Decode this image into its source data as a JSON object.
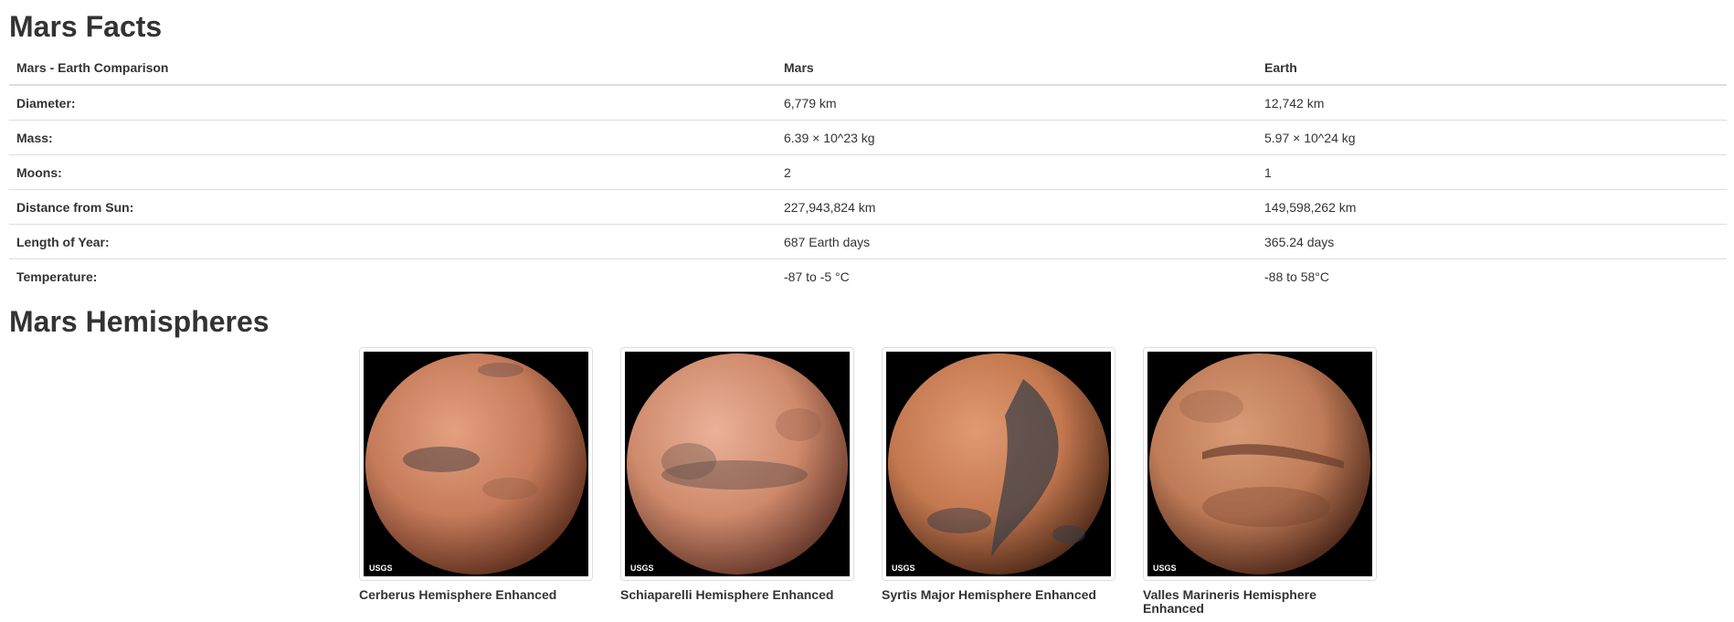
{
  "facts": {
    "title": "Mars Facts",
    "headers": [
      "Mars - Earth Comparison",
      "Mars",
      "Earth"
    ],
    "rows": [
      [
        "Diameter:",
        "6,779 km",
        "12,742 km"
      ],
      [
        "Mass:",
        "6.39 × 10^23 kg",
        "5.97 × 10^24 kg"
      ],
      [
        "Moons:",
        "2",
        "1"
      ],
      [
        "Distance from Sun:",
        "227,943,824 km",
        "149,598,262 km"
      ],
      [
        "Length of Year:",
        "687 Earth days",
        "365.24 days"
      ],
      [
        "Temperature:",
        "-87 to -5 °C",
        "-88 to 58°C"
      ]
    ]
  },
  "hemispheres": {
    "title": "Mars Hemispheres",
    "items": [
      {
        "title": "Cerberus Hemisphere Enhanced",
        "watermark": "USGS",
        "base": "#c67b5a",
        "dark": "#4e4444"
      },
      {
        "title": "Schiaparelli Hemisphere Enhanced",
        "watermark": "USGS",
        "base": "#cf8a6c",
        "dark": "#5c4a44"
      },
      {
        "title": "Syrtis Major Hemisphere Enhanced",
        "watermark": "USGS",
        "base": "#c4784f",
        "dark": "#353c46"
      },
      {
        "title": "Valles Marineris Hemisphere Enhanced",
        "watermark": "USGS",
        "base": "#bf7b57",
        "dark": "#6a3d2c"
      }
    ]
  }
}
